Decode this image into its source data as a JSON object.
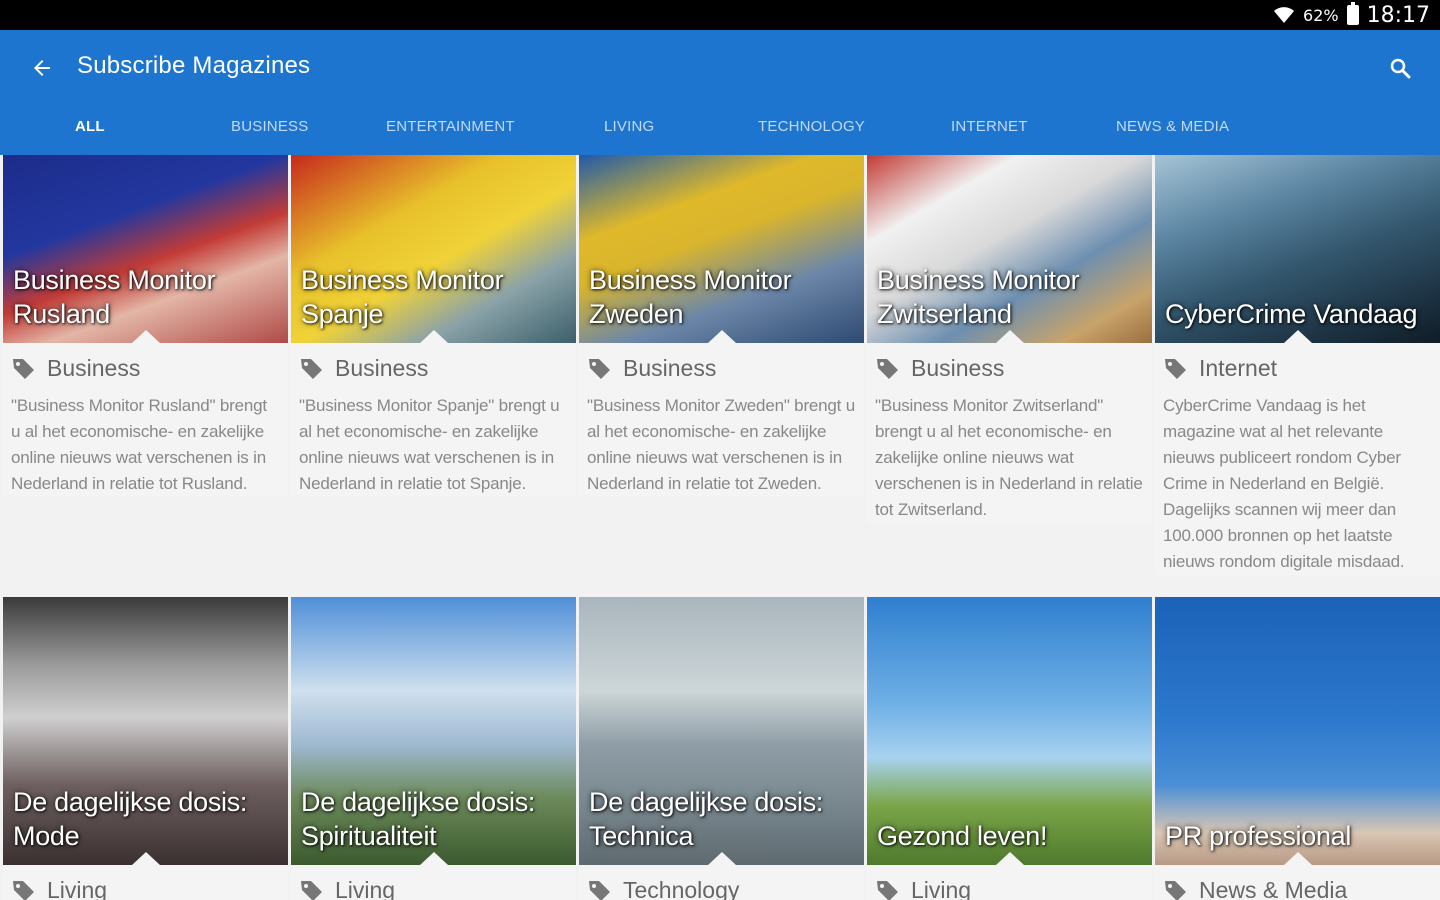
{
  "status": {
    "battery": "62%",
    "time": "18:17"
  },
  "app_bar": {
    "title": "Subscribe Magazines"
  },
  "tabs": [
    "ALL",
    "BUSINESS",
    "ENTERTAINMENT",
    "LIVING",
    "TECHNOLOGY",
    "INTERNET",
    "NEWS & MEDIA"
  ],
  "magazines": [
    {
      "title": "Business Monitor Rusland",
      "category": "Business",
      "description": "\"Business Monitor Rusland\" brengt u al het economische- en zakelijke online nieuws wat verschenen is in Nederland in relatie tot Rusland."
    },
    {
      "title": "Business Monitor Spanje",
      "category": "Business",
      "description": "\"Business Monitor Spanje\" brengt u al het economische- en zakelijke online nieuws wat verschenen is in Nederland in relatie tot Spanje."
    },
    {
      "title": "Business Monitor Zweden",
      "category": "Business",
      "description": "\"Business Monitor Zweden\" brengt u al het economische- en zakelijke online nieuws wat verschenen is in Nederland in relatie tot Zweden."
    },
    {
      "title": "Business Monitor Zwitserland",
      "category": "Business",
      "description": "\"Business Monitor Zwitserland\" brengt u al het economische- en zakelijke online nieuws wat verschenen is in Nederland in relatie tot Zwitserland."
    },
    {
      "title": "CyberCrime Vandaag",
      "category": "Internet",
      "description": "CyberCrime Vandaag is het magazine wat al het relevante nieuws publiceert rondom Cyber Crime in Nederland en België. Dagelijks scannen wij meer dan 100.000 bronnen op het laatste nieuws rondom digitale misdaad."
    },
    {
      "title": "De dagelijkse dosis: Mode",
      "category": "Living",
      "description": ""
    },
    {
      "title": "De dagelijkse dosis: Spiritualiteit",
      "category": "Living",
      "description": ""
    },
    {
      "title": "De dagelijkse dosis: Technica",
      "category": "Technology",
      "description": ""
    },
    {
      "title": "Gezond leven!",
      "category": "Living",
      "description": ""
    },
    {
      "title": "PR professional",
      "category": "News & Media",
      "description": ""
    }
  ]
}
